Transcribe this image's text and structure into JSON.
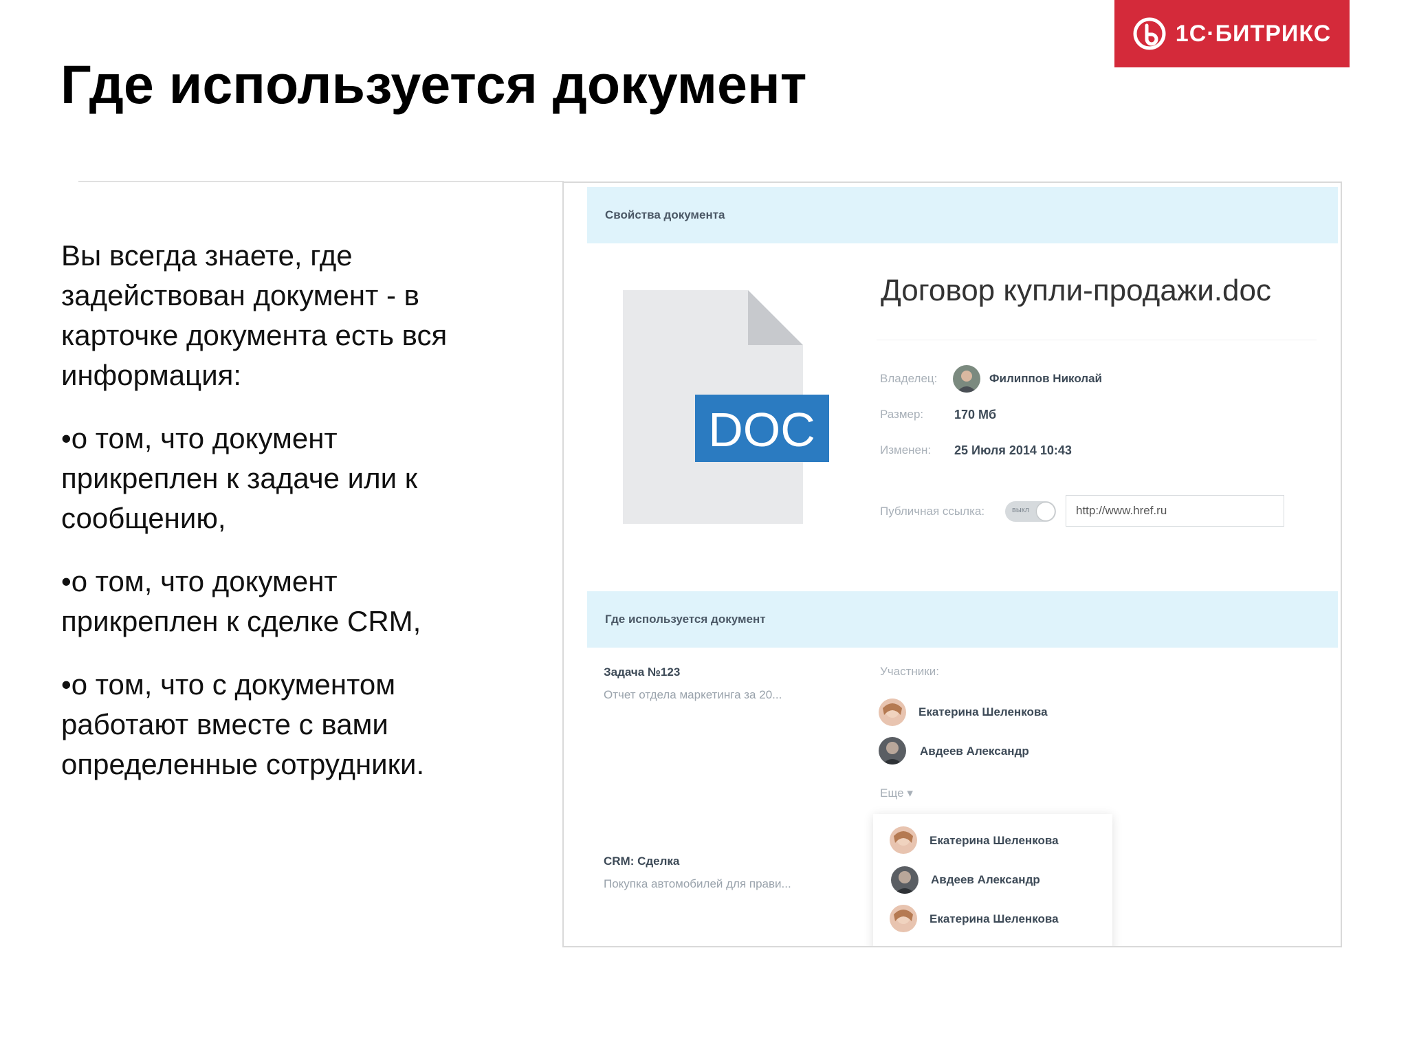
{
  "brand": {
    "logo_text": "1С·БИТРИКС",
    "color": "#d42a3a"
  },
  "slide": {
    "title": "Где используется документ",
    "paragraphs": [
      "Вы всегда знаете, где задействован документ - в карточке документа есть вся информация:",
      "•о том, что документ прикреплен к задаче или к сообщению,",
      "•о том, что документ прикреплен к сделке CRM,",
      "•о том, что с документом работают вместе с вами определенные сотрудники."
    ]
  },
  "screenshot": {
    "properties_header": "Свойства документа",
    "file_icon": {
      "name": "doc-file-icon",
      "badge": "DOC",
      "badge_color": "#2b7bc1"
    },
    "document_name": "Договор купли-продажи.doc",
    "owner_label": "Владелец:",
    "owner_name": "Филиппов Николай",
    "size_label": "Размер:",
    "size_value": "170 Мб",
    "modified_label": "Изменен:",
    "modified_value": "25 Июля 2014 10:43",
    "public_link_label": "Публичная ссылка:",
    "toggle_label": "выкл",
    "url_value": "http://www.href.ru",
    "usage_header": "Где используется документ",
    "task_title": "Задача №123",
    "task_subtitle": "Отчет отдела маркетинга за 20...",
    "participants_label": "Участники:",
    "participants": [
      "Екатерина Шеленкова",
      "Авдеев Александр"
    ],
    "more_label": "Еще",
    "dropdown_people": [
      "Екатерина Шеленкова",
      "Авдеев Александр",
      "Екатерина Шеленкова"
    ],
    "crm_title": "CRM: Сделка",
    "crm_subtitle": "Покупка автомобилей для прави..."
  }
}
